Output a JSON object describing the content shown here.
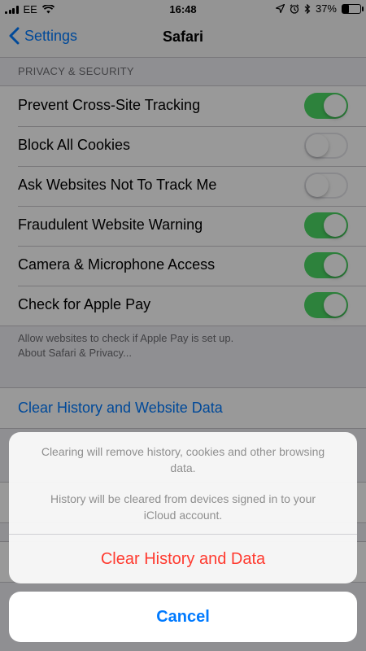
{
  "status_bar": {
    "carrier": "EE",
    "time": "16:48",
    "battery_percent": "37%",
    "battery_level": 0.37,
    "icons": [
      "signal-icon",
      "wifi-icon",
      "location-icon",
      "alarm-icon",
      "bluetooth-icon",
      "battery-icon"
    ]
  },
  "nav": {
    "back_label": "Settings",
    "title": "Safari"
  },
  "privacy": {
    "header": "PRIVACY & SECURITY",
    "rows": [
      {
        "label": "Prevent Cross-Site Tracking",
        "on": true
      },
      {
        "label": "Block All Cookies",
        "on": false
      },
      {
        "label": "Ask Websites Not To Track Me",
        "on": false
      },
      {
        "label": "Fraudulent Website Warning",
        "on": true
      },
      {
        "label": "Camera & Microphone Access",
        "on": true
      },
      {
        "label": "Check for Apple Pay",
        "on": true
      }
    ],
    "footer_line1": "Allow websites to check if Apple Pay is set up.",
    "footer_link": "About Safari & Privacy..."
  },
  "clear_history_link": "Clear History and Website Data",
  "action_sheet": {
    "message_1": "Clearing will remove history, cookies and other browsing data.",
    "message_2": "History will be cleared from devices signed in to your iCloud account.",
    "destructive_label": "Clear History and Data",
    "cancel_label": "Cancel"
  },
  "colors": {
    "accent": "#007aff",
    "toggle_on": "#4cd964",
    "destructive": "#ff3b30"
  }
}
